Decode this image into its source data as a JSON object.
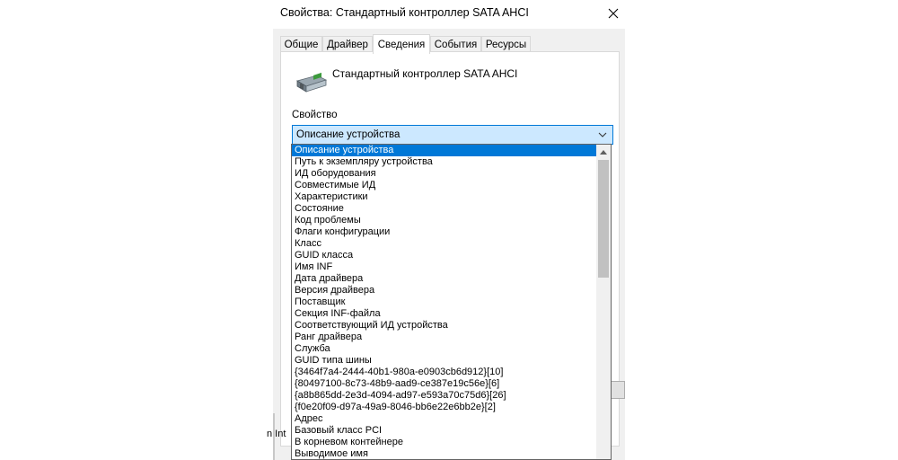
{
  "window": {
    "title": "Свойства: Стандартный контроллер SATA AHCI"
  },
  "tabs": [
    {
      "label": "Общие"
    },
    {
      "label": "Драйвер"
    },
    {
      "label": "Сведения"
    },
    {
      "label": "События"
    },
    {
      "label": "Ресурсы"
    }
  ],
  "active_tab": "Сведения",
  "details": {
    "device_name": "Стандартный контроллер SATA AHCI",
    "property_label": "Свойство",
    "selected_property": "Описание устройства"
  },
  "dropdown": {
    "items": [
      "Описание устройства",
      "Путь к экземпляру устройства",
      "ИД оборудования",
      "Совместимые ИД",
      "Характеристики",
      "Состояние",
      "Код проблемы",
      "Флаги конфигурации",
      "Класс",
      "GUID класса",
      "Имя INF",
      "Дата драйвера",
      "Версия драйвера",
      "Поставщик",
      "Секция INF-файла",
      "Соответствующий ИД устройства",
      "Ранг драйвера",
      "Служба",
      "GUID типа шины",
      "{3464f7a4-2444-40b1-980a-e0903cb6d912}[10]",
      "{80497100-8c73-48b9-aad9-ce387e19c56e}[6]",
      "{a8b865dd-2e3d-4094-ad97-e593a70c75d6}[26]",
      "{f0e20f09-d97a-49a9-8046-bb6e22e6bb2e}[2]",
      "Адрес",
      "Базовый класс PCI",
      "В корневом контейнере",
      "Выводимое имя"
    ]
  },
  "background": {
    "partial_text": "n Int"
  },
  "colors": {
    "selection": "#0078d7",
    "combo_highlight": "#cce8ff",
    "dialog_bg": "#f0f0f0"
  }
}
